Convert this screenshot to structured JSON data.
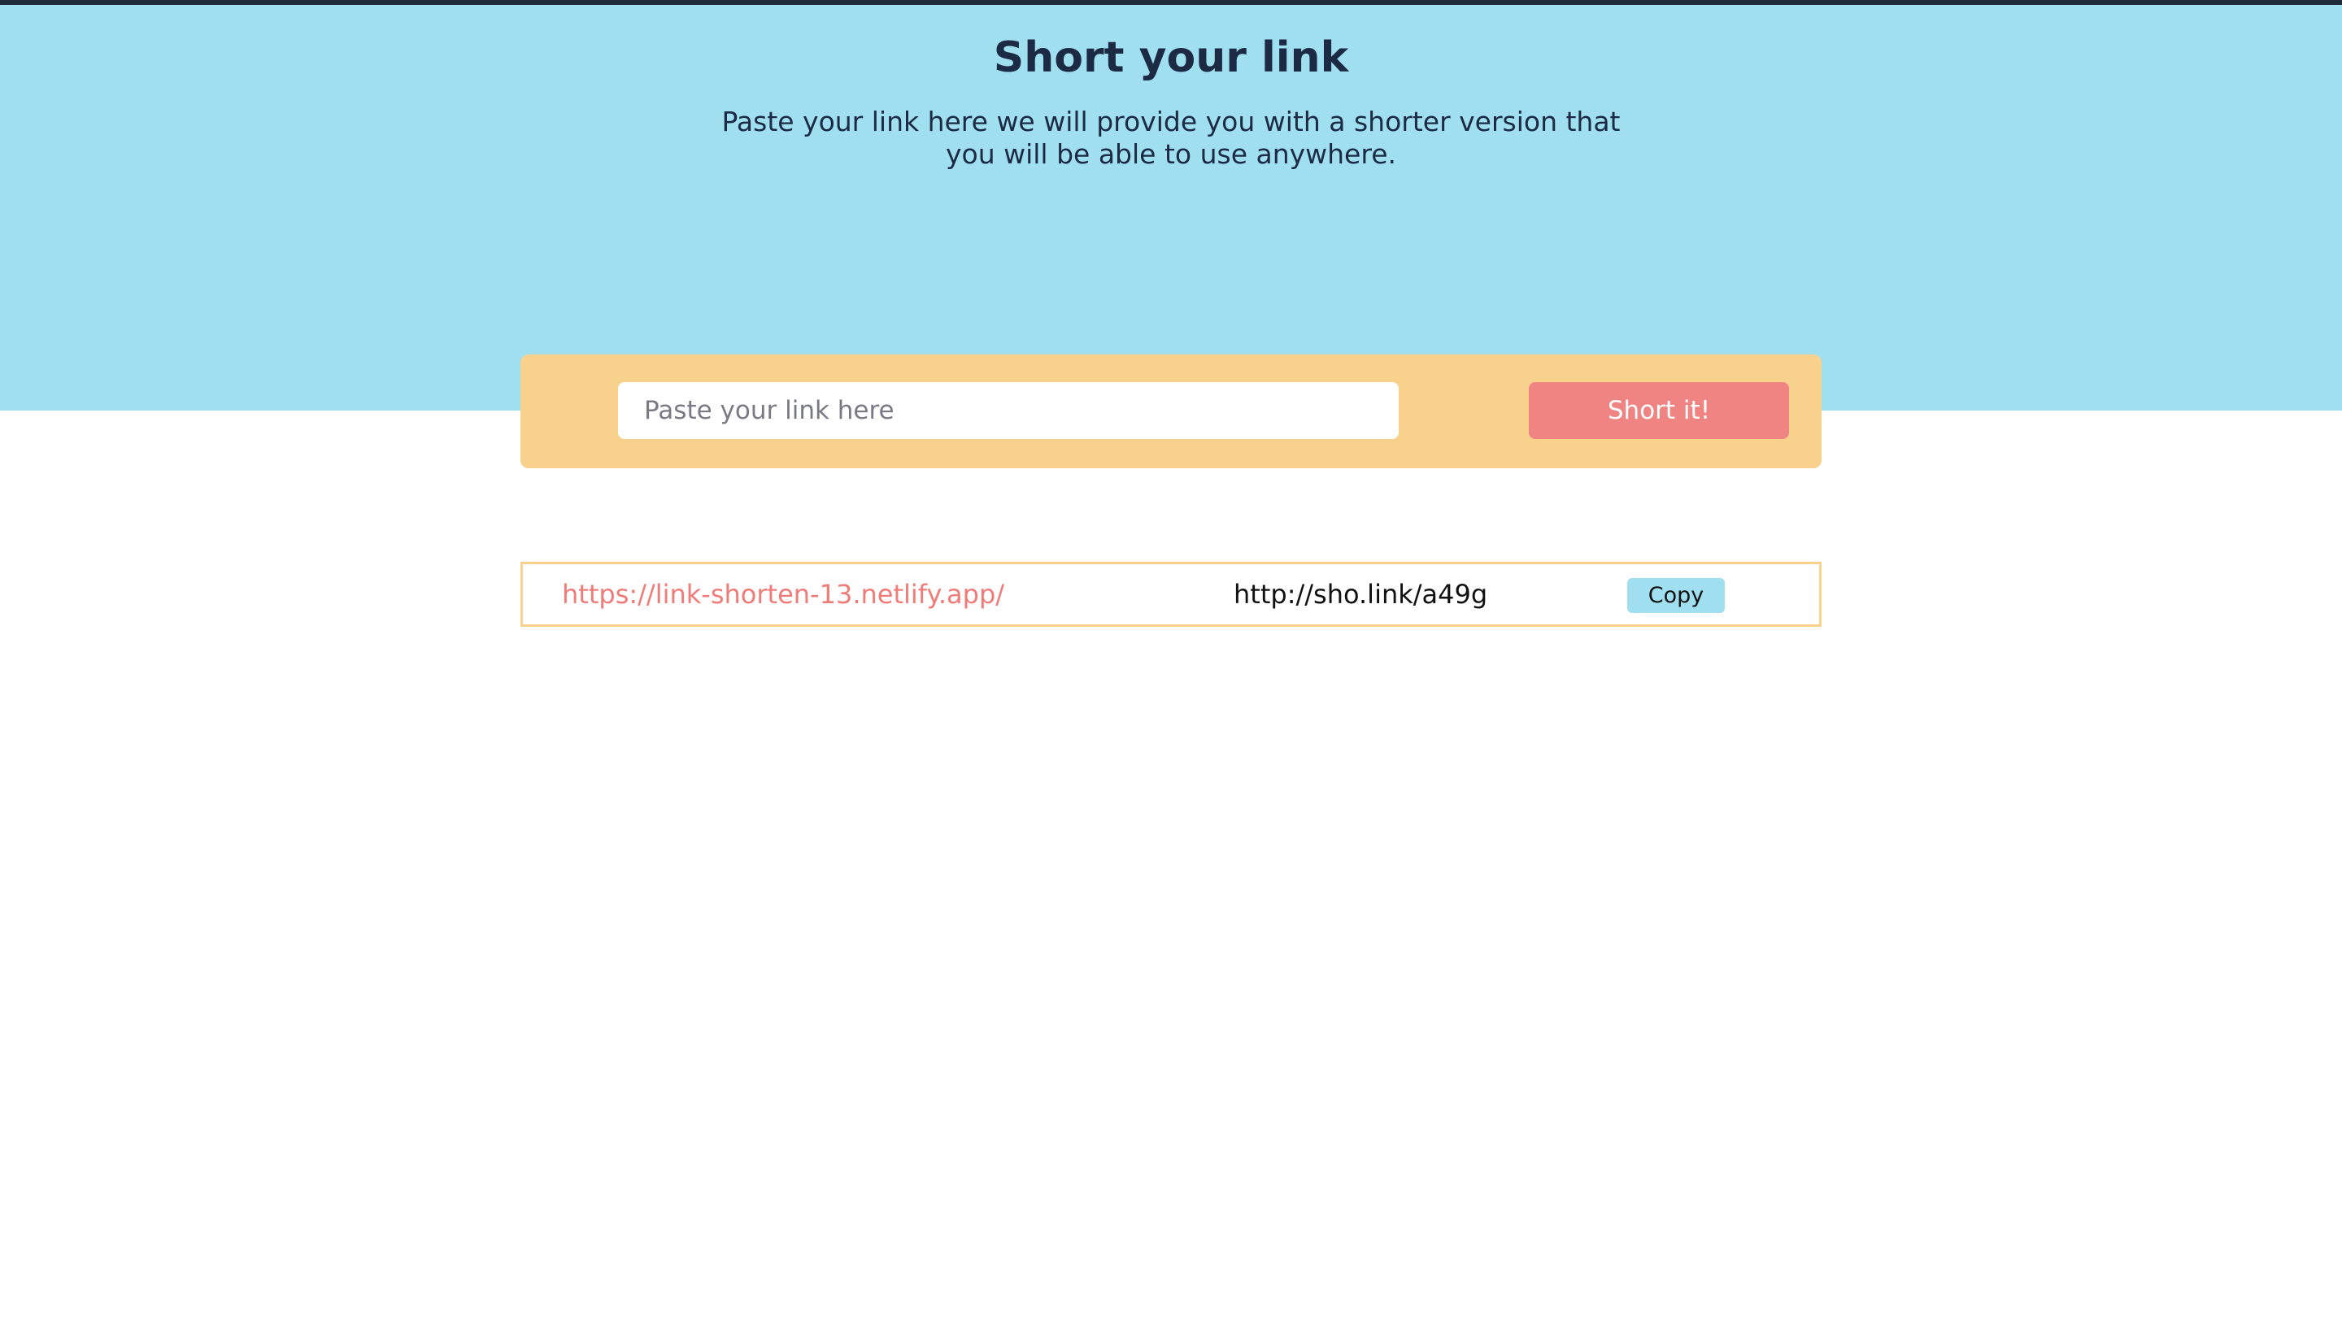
{
  "header": {
    "title": "Short your link",
    "subtitle": "Paste your link here we will provide you with a shorter version that you will be able to use anywhere."
  },
  "shortener": {
    "input_value": "",
    "input_placeholder": "Paste your link here",
    "submit_label": "Short it!"
  },
  "results": [
    {
      "original_url": "https://link-shorten-13.netlify.app/",
      "short_url": "http://sho.link/a49g",
      "copy_label": "Copy"
    }
  ],
  "colors": {
    "hero_background": "#9fdfef",
    "form_background": "#f8d28c",
    "button_accent": "#ef8482",
    "link_color": "#ef7c78",
    "title_color": "#1d2a44"
  }
}
